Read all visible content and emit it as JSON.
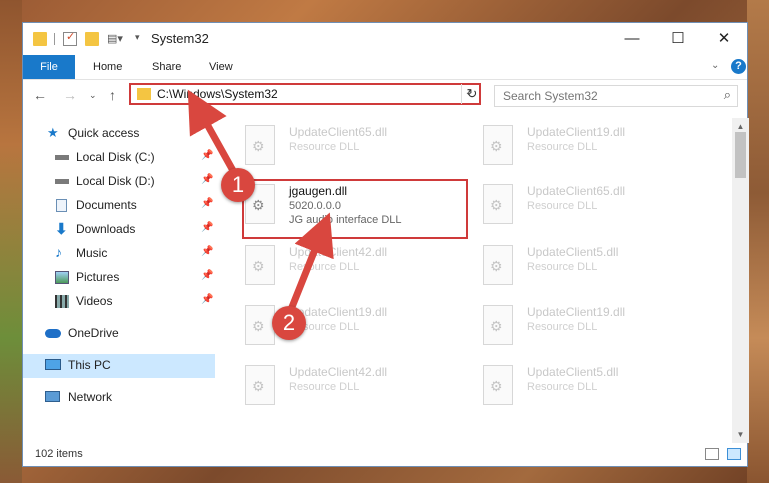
{
  "window": {
    "title": "System32",
    "controls": {
      "minimize": "—",
      "maximize": "☐",
      "close": "✕"
    }
  },
  "ribbon": {
    "tabs": [
      "File",
      "Home",
      "Share",
      "View"
    ],
    "help": "?"
  },
  "navigation": {
    "address": "C:\\Windows\\System32",
    "search_placeholder": "Search System32"
  },
  "sidebar": {
    "items": [
      {
        "label": "Quick access",
        "icon": "star-icon",
        "pinned": false
      },
      {
        "label": "Local Disk (C:)",
        "icon": "drive-icon",
        "pinned": true
      },
      {
        "label": "Local Disk (D:)",
        "icon": "drive-icon",
        "pinned": true
      },
      {
        "label": "Documents",
        "icon": "documents-icon",
        "pinned": true
      },
      {
        "label": "Downloads",
        "icon": "downloads-icon",
        "pinned": true
      },
      {
        "label": "Music",
        "icon": "music-icon",
        "pinned": true
      },
      {
        "label": "Pictures",
        "icon": "pictures-icon",
        "pinned": true
      },
      {
        "label": "Videos",
        "icon": "videos-icon",
        "pinned": true
      },
      {
        "label": "OneDrive",
        "icon": "cloud-icon",
        "pinned": false
      },
      {
        "label": "This PC",
        "icon": "computer-icon",
        "pinned": false,
        "selected": true
      },
      {
        "label": "Network",
        "icon": "network-icon",
        "pinned": false
      }
    ]
  },
  "files": [
    {
      "name": "UpdateClient65.dll",
      "type": "Resource DLL"
    },
    {
      "name": "UpdateClient19.dll",
      "type": "Resource DLL"
    },
    {
      "name": "jgaugen.dll",
      "type": "5020.0.0.0",
      "description": "JG audio interface DLL",
      "active": true
    },
    {
      "name": "UpdateClient65.dll",
      "type": "Resource DLL"
    },
    {
      "name": "UpdateClient42.dll",
      "type": "Resource DLL"
    },
    {
      "name": "UpdateClient5.dll",
      "type": "Resource DLL"
    },
    {
      "name": "UpdateClient19.dll",
      "type": "Resource DLL"
    },
    {
      "name": "UpdateClient19.dll",
      "type": "Resource DLL"
    },
    {
      "name": "UpdateClient42.dll",
      "type": "Resource DLL"
    },
    {
      "name": "UpdateClient5.dll",
      "type": "Resource DLL"
    }
  ],
  "status": {
    "item_count": "102 items"
  },
  "callouts": [
    "1",
    "2"
  ],
  "colors": {
    "accent": "#1979ca",
    "highlight": "#cf3a3a",
    "badge": "#d9473f"
  }
}
